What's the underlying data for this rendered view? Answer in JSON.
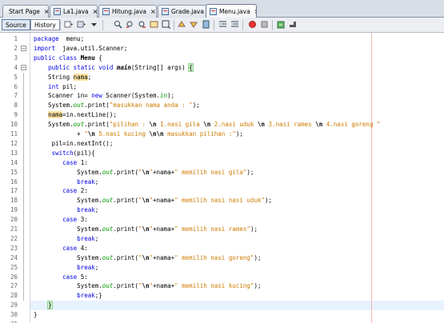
{
  "tabs": [
    {
      "label": "Start Page",
      "icon": "none",
      "active": false
    },
    {
      "label": "La1.java",
      "icon": "java-file-icon",
      "active": false
    },
    {
      "label": "Hitung.java",
      "icon": "java-file-icon",
      "active": false
    },
    {
      "label": "Grade.java",
      "icon": "java-file-icon",
      "active": false
    },
    {
      "label": "Menu.java",
      "icon": "java-file-icon",
      "active": true
    }
  ],
  "toolbar": {
    "source_label": "Source",
    "history_label": "History",
    "icons": [
      "navigate-back-icon",
      "navigate-forward-icon",
      "search-icon",
      "find-previous-icon",
      "find-next-icon",
      "toggle-highlight-icon",
      "toggle-rect-selection-icon",
      "previous-bookmark-icon",
      "next-bookmark-icon",
      "toggle-bookmark-icon",
      "shift-left-icon",
      "shift-right-icon",
      "start-macro-icon",
      "stop-macro-icon",
      "comment-icon",
      "uncomment-icon"
    ]
  },
  "editor": {
    "current_line": 29,
    "lines": [
      {
        "n": "1",
        "segments": [
          [
            "kw",
            "package"
          ],
          [
            "",
            "  menu;"
          ]
        ]
      },
      {
        "n": "2",
        "segments": [
          [
            "kw",
            "import"
          ],
          [
            "",
            "  java.util.Scanner;"
          ]
        ],
        "fold": "-"
      },
      {
        "n": "3",
        "segments": [
          [
            "kw",
            "public class"
          ],
          [
            "",
            " "
          ],
          [
            "bold",
            "Menu"
          ],
          [
            "",
            " {"
          ]
        ]
      },
      {
        "n": "4",
        "segments": [
          [
            "",
            "    "
          ],
          [
            "kw",
            "public static void"
          ],
          [
            "",
            " "
          ],
          [
            "meth",
            "main"
          ],
          [
            "",
            "(String[] args) "
          ],
          [
            "brace",
            "{"
          ]
        ],
        "fold": "-"
      },
      {
        "n": "5",
        "segments": [
          [
            "",
            "    String "
          ],
          [
            "hl",
            "nama"
          ],
          [
            "",
            ";"
          ]
        ]
      },
      {
        "n": "6",
        "segments": [
          [
            "",
            "    "
          ],
          [
            "kw",
            "int"
          ],
          [
            "",
            " pil;"
          ]
        ]
      },
      {
        "n": "7",
        "segments": [
          [
            "",
            "    Scanner in= "
          ],
          [
            "kw",
            "new"
          ],
          [
            "",
            " Scanner(System."
          ],
          [
            "fld",
            "in"
          ],
          [
            "",
            ");"
          ]
        ]
      },
      {
        "n": "8",
        "segments": [
          [
            "",
            "    System."
          ],
          [
            "fld",
            "out"
          ],
          [
            "",
            ".print("
          ],
          [
            "str",
            "\"masukkan nama anda : \""
          ],
          [
            "",
            ");"
          ]
        ]
      },
      {
        "n": "9",
        "segments": [
          [
            "",
            "    "
          ],
          [
            "hl",
            "nama"
          ],
          [
            "",
            "=in.nextLine();"
          ]
        ]
      },
      {
        "n": "10",
        "segments": [
          [
            "",
            "    System."
          ],
          [
            "fld",
            "out"
          ],
          [
            "",
            ".print("
          ],
          [
            "str",
            "\"pilihan : "
          ],
          [
            "bold",
            "\\n"
          ],
          [
            "str",
            " 1.nasi gila "
          ],
          [
            "bold",
            "\\n"
          ],
          [
            "str",
            " 2.nasi uduk "
          ],
          [
            "bold",
            "\\n"
          ],
          [
            "str",
            " 3.nasi rames "
          ],
          [
            "bold",
            "\\n"
          ],
          [
            "str",
            " 4.nasi goreng \""
          ]
        ]
      },
      {
        "n": "11",
        "segments": [
          [
            "",
            "            + "
          ],
          [
            "str",
            "\""
          ],
          [
            "bold",
            "\\n"
          ],
          [
            "str",
            " 5.nasi kucing "
          ],
          [
            "bold",
            "\\n\\n"
          ],
          [
            "str",
            " masukkan pilihan :\""
          ],
          [
            "",
            ");"
          ]
        ]
      },
      {
        "n": "12",
        "segments": [
          [
            "",
            "     pil=in.nextInt();"
          ]
        ]
      },
      {
        "n": "13",
        "segments": [
          [
            "",
            "     "
          ],
          [
            "kw",
            "switch"
          ],
          [
            "",
            "(pil){"
          ]
        ]
      },
      {
        "n": "14",
        "segments": [
          [
            "",
            "        "
          ],
          [
            "kw",
            "case"
          ],
          [
            "",
            " 1:"
          ]
        ]
      },
      {
        "n": "15",
        "segments": [
          [
            "",
            "            System."
          ],
          [
            "fld",
            "out"
          ],
          [
            "",
            ".print("
          ],
          [
            "str",
            "\""
          ],
          [
            "bold",
            "\\n"
          ],
          [
            "str",
            "\""
          ],
          [
            "",
            "+nama+"
          ],
          [
            "str",
            "\" memilih nasi gila\""
          ],
          [
            "",
            ");"
          ]
        ]
      },
      {
        "n": "16",
        "segments": [
          [
            "",
            "            "
          ],
          [
            "kw",
            "break"
          ],
          [
            "",
            ";"
          ]
        ]
      },
      {
        "n": "17",
        "segments": [
          [
            "",
            "        "
          ],
          [
            "kw",
            "case"
          ],
          [
            "",
            " 2:"
          ]
        ]
      },
      {
        "n": "18",
        "segments": [
          [
            "",
            "            System."
          ],
          [
            "fld",
            "out"
          ],
          [
            "",
            ".print("
          ],
          [
            "str",
            "\""
          ],
          [
            "bold",
            "\\n"
          ],
          [
            "str",
            "\""
          ],
          [
            "",
            "+nama+"
          ],
          [
            "str",
            "\" memilih nasi nasi uduk\""
          ],
          [
            "",
            ");"
          ]
        ]
      },
      {
        "n": "19",
        "segments": [
          [
            "",
            "            "
          ],
          [
            "kw",
            "break"
          ],
          [
            "",
            ";"
          ]
        ]
      },
      {
        "n": "20",
        "segments": [
          [
            "",
            "        "
          ],
          [
            "kw",
            "case"
          ],
          [
            "",
            " 3:"
          ]
        ]
      },
      {
        "n": "21",
        "segments": [
          [
            "",
            "            System."
          ],
          [
            "fld",
            "out"
          ],
          [
            "",
            ".print("
          ],
          [
            "str",
            "\""
          ],
          [
            "bold",
            "\\n"
          ],
          [
            "str",
            "\""
          ],
          [
            "",
            "+nama+"
          ],
          [
            "str",
            "\" memilih nasi rames\""
          ],
          [
            "",
            ");"
          ]
        ]
      },
      {
        "n": "22",
        "segments": [
          [
            "",
            "            "
          ],
          [
            "kw",
            "break"
          ],
          [
            "",
            ";"
          ]
        ]
      },
      {
        "n": "23",
        "segments": [
          [
            "",
            "        "
          ],
          [
            "kw",
            "case"
          ],
          [
            "",
            " 4:"
          ]
        ]
      },
      {
        "n": "24",
        "segments": [
          [
            "",
            "            System."
          ],
          [
            "fld",
            "out"
          ],
          [
            "",
            ".print("
          ],
          [
            "str",
            "\""
          ],
          [
            "bold",
            "\\n"
          ],
          [
            "str",
            "\""
          ],
          [
            "",
            "+nama+"
          ],
          [
            "str",
            "\" memilih nasi goreng\""
          ],
          [
            "",
            ");"
          ]
        ]
      },
      {
        "n": "25",
        "segments": [
          [
            "",
            "            "
          ],
          [
            "kw",
            "break"
          ],
          [
            "",
            ";"
          ]
        ]
      },
      {
        "n": "26",
        "segments": [
          [
            "",
            "        "
          ],
          [
            "kw",
            "case"
          ],
          [
            "",
            " 5:"
          ]
        ]
      },
      {
        "n": "27",
        "segments": [
          [
            "",
            "            System."
          ],
          [
            "fld",
            "out"
          ],
          [
            "",
            ".print("
          ],
          [
            "str",
            "\""
          ],
          [
            "bold",
            "\\n"
          ],
          [
            "str",
            "\""
          ],
          [
            "",
            "+nama+"
          ],
          [
            "str",
            "\" memilih nasi kucing\""
          ],
          [
            "",
            ");"
          ]
        ]
      },
      {
        "n": "28",
        "segments": [
          [
            "",
            "            "
          ],
          [
            "kw",
            "break"
          ],
          [
            "",
            ";}"
          ]
        ]
      },
      {
        "n": "29",
        "segments": [
          [
            "",
            "    "
          ],
          [
            "brace",
            "}"
          ]
        ]
      },
      {
        "n": "30",
        "segments": [
          [
            "",
            "}"
          ]
        ]
      },
      {
        "n": "31",
        "segments": []
      }
    ]
  },
  "colors": {
    "keyword": "#0000e6",
    "string": "#ce7b00",
    "field": "#009900",
    "highlight": "#ffe4a3",
    "margin_line": "#f2b4b4"
  }
}
